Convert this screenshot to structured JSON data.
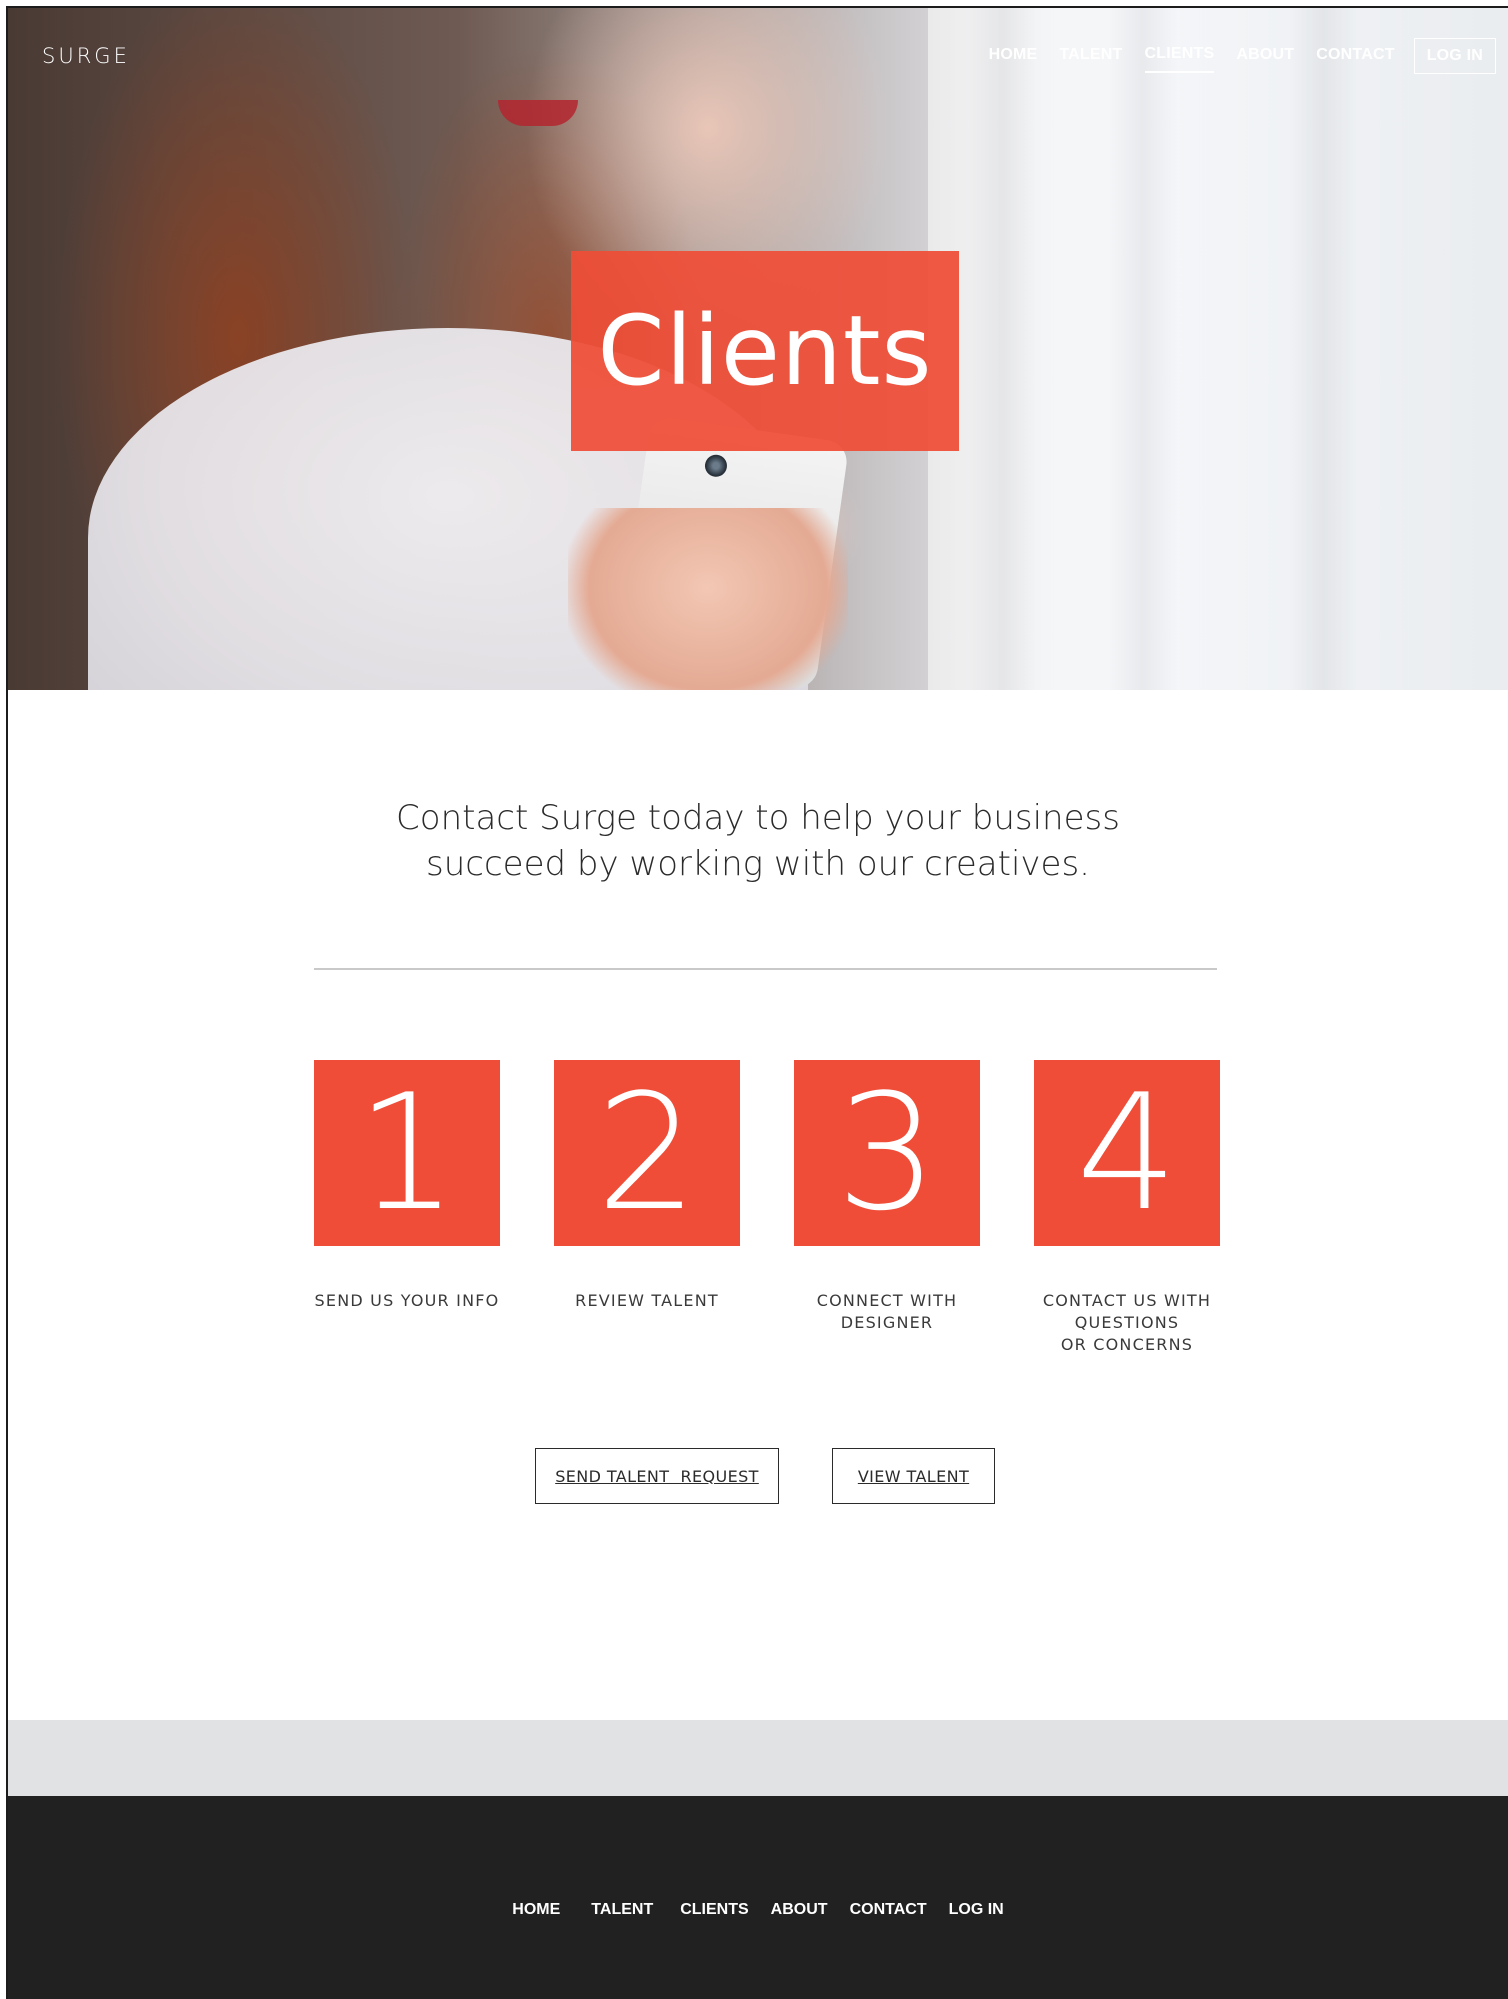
{
  "brand": {
    "logo": "SURGE"
  },
  "nav": {
    "items": [
      {
        "label": "HOME",
        "active": false
      },
      {
        "label": "TALENT",
        "active": false
      },
      {
        "label": "CLIENTS",
        "active": true
      },
      {
        "label": "ABOUT",
        "active": false
      },
      {
        "label": "CONTACT",
        "active": false
      }
    ],
    "login": "LOG IN"
  },
  "hero": {
    "title": "Clients"
  },
  "intro": {
    "line1": "Contact Surge today to help your business",
    "line2": "succeed by working with our creatives."
  },
  "steps": [
    {
      "number": "1",
      "label_lines": [
        "SEND US YOUR INFO"
      ]
    },
    {
      "number": "2",
      "label_lines": [
        "REVIEW TALENT"
      ]
    },
    {
      "number": "3",
      "label_lines": [
        "CONNECT WITH",
        "DESIGNER"
      ]
    },
    {
      "number": "4",
      "label_lines": [
        "CONTACT US WITH",
        "QUESTIONS",
        "OR CONCERNS"
      ]
    }
  ],
  "buttons": {
    "send_request": "SEND TALENT  REQUEST",
    "view_talent": "VIEW TALENT"
  },
  "footer": {
    "nav": [
      "HOME",
      "TALENT",
      "CLIENTS",
      "ABOUT",
      "CONTACT",
      "LOG IN"
    ]
  },
  "colors": {
    "accent": "#ef4d38",
    "footer_bg": "#212121",
    "band_bg": "#e1e2e4"
  }
}
